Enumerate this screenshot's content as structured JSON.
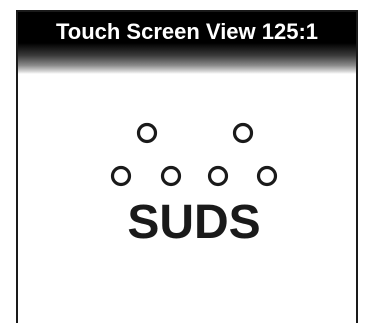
{
  "window": {
    "title": "Touch Screen View 125:1"
  },
  "display": {
    "label": "SUDS",
    "icon": "suds-bubbles-icon",
    "colors": {
      "title_bar": "#000000",
      "title_text": "#ffffff",
      "background": "#ffffff",
      "foreground": "#1a1a1a"
    }
  }
}
